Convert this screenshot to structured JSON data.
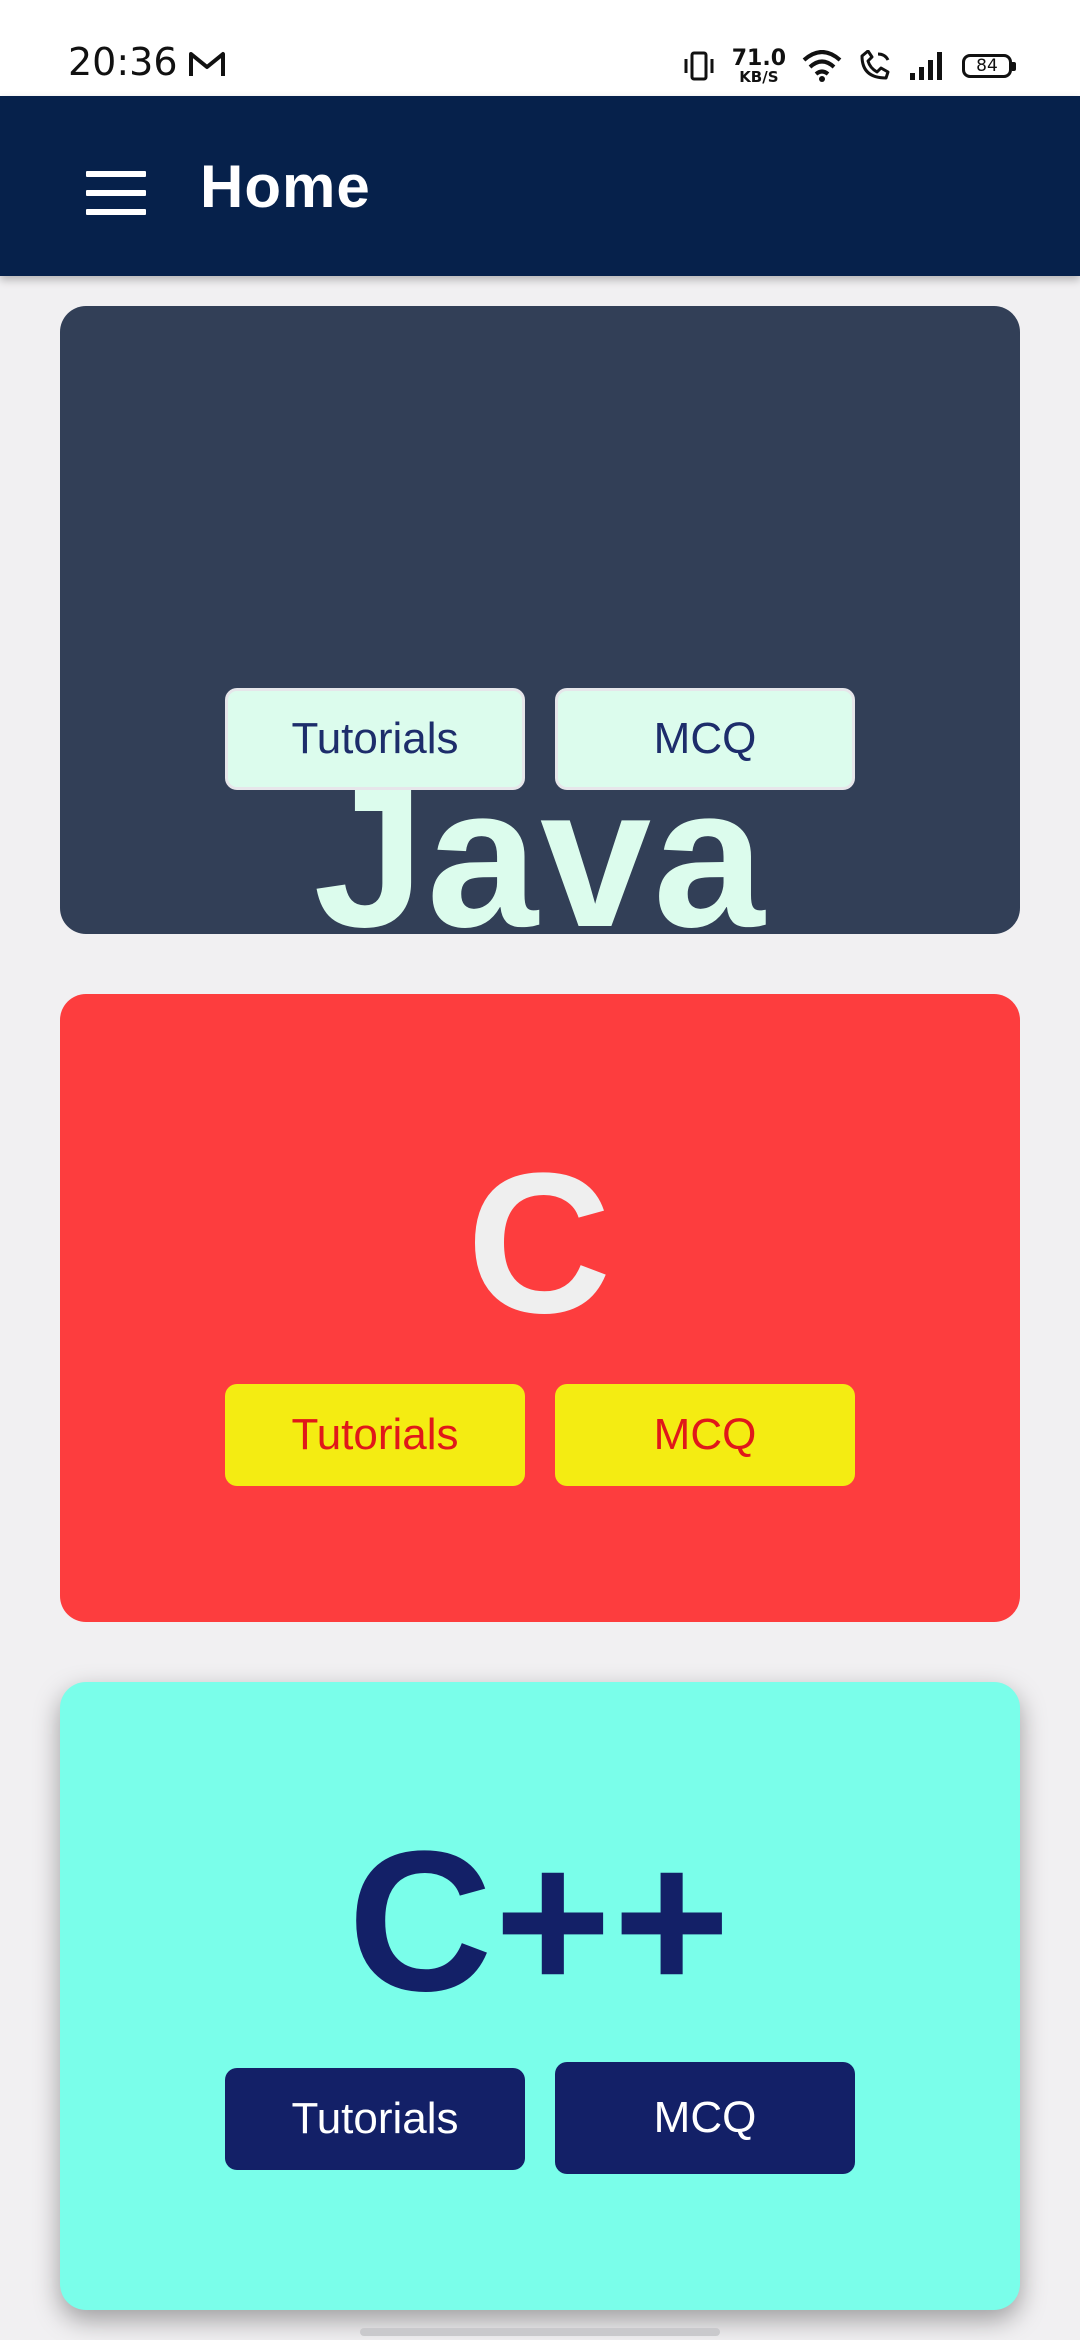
{
  "status_bar": {
    "time": "20:36",
    "notification_icon": "gmail-icon",
    "icons": [
      "vibrate-icon",
      "wifi-icon",
      "wifi-call-icon",
      "signal-icon"
    ],
    "speed_value": "71.0",
    "speed_unit": "KB/S",
    "battery_level": "84"
  },
  "app_bar": {
    "menu_icon": "hamburger-menu-icon",
    "title": "Home",
    "background_color": "#06214b"
  },
  "cards": [
    {
      "title": "Java",
      "tutorials_label": "Tutorials",
      "mcq_label": "MCQ",
      "background_color": "#323f57",
      "title_color": "#dcfced",
      "button_color": "#dcfced",
      "button_text_color": "#1d2d6b"
    },
    {
      "title": "C",
      "tutorials_label": "Tutorials",
      "mcq_label": "MCQ",
      "background_color": "#fd3d3e",
      "title_color": "#efefef",
      "button_color": "#f4ec12",
      "button_text_color": "#e0181a"
    },
    {
      "title": "C++",
      "tutorials_label": "Tutorials",
      "mcq_label": "MCQ",
      "background_color": "#7afeea",
      "title_color": "#132067",
      "button_color": "#132067",
      "button_text_color": "#ffffff"
    }
  ]
}
